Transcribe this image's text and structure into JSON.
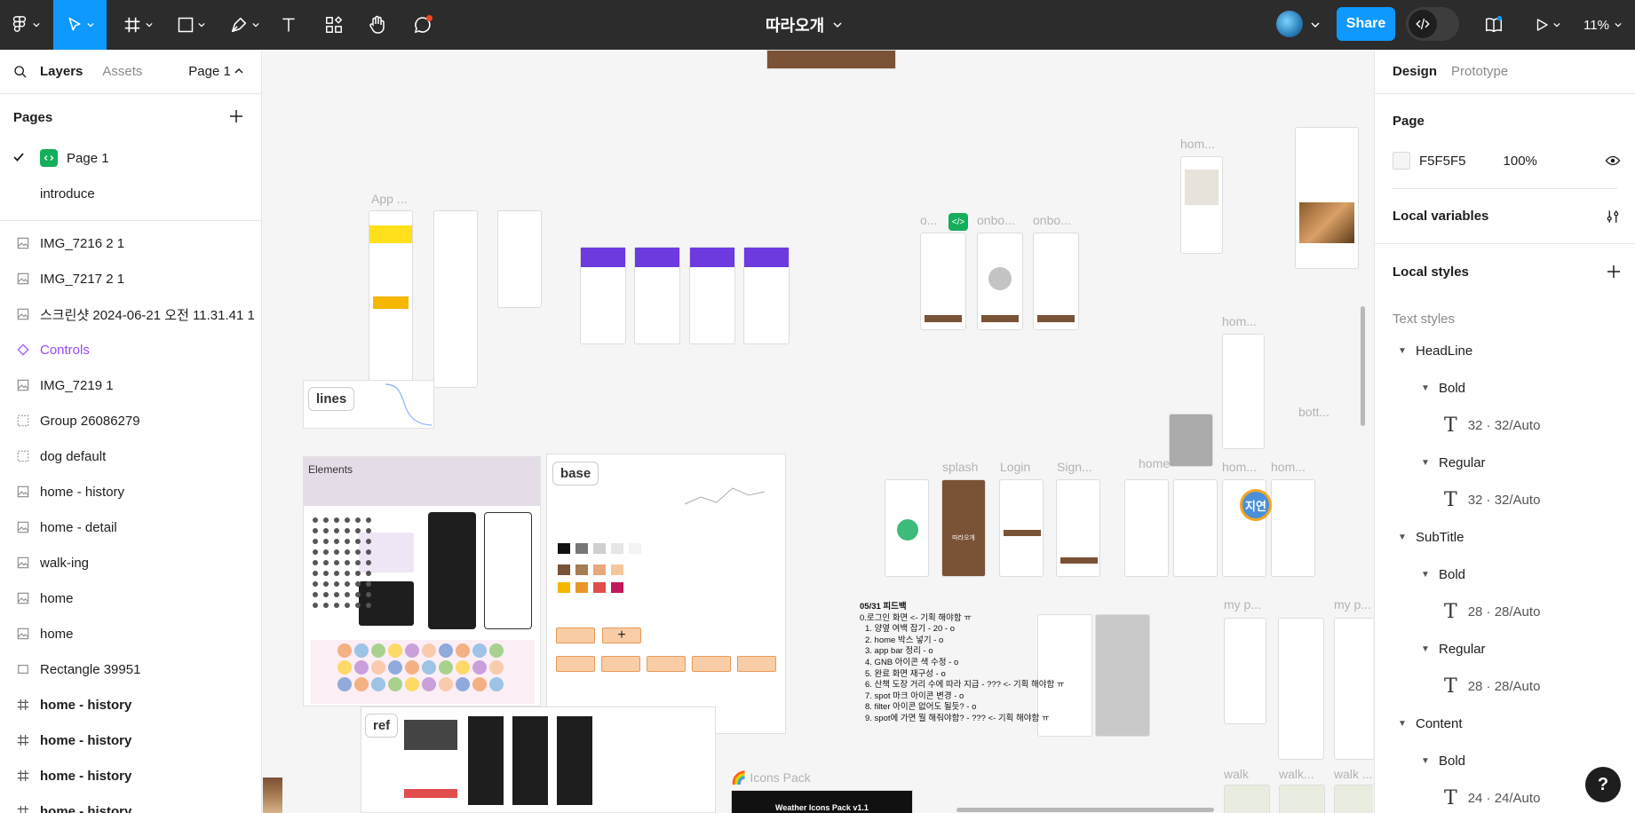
{
  "toolbar": {
    "doc_title": "따라오개",
    "share_label": "Share",
    "zoom": "11%",
    "colors": {
      "bg": "#2c2c2c",
      "accent": "#0d99ff"
    }
  },
  "left_panel": {
    "tabs": {
      "layers": "Layers",
      "assets": "Assets"
    },
    "page_selector": "Page 1",
    "pages_heading": "Pages",
    "pages": [
      {
        "label": "Page 1",
        "selected": true
      },
      {
        "label": "introduce",
        "selected": false
      }
    ],
    "layers": [
      {
        "label": "IMG_7216 2 1",
        "type": "image"
      },
      {
        "label": "IMG_7217 2 1",
        "type": "image"
      },
      {
        "label": "스크린샷 2024-06-21 오전 11.31.41 1",
        "type": "image"
      },
      {
        "label": "Controls",
        "type": "component"
      },
      {
        "label": "IMG_7219 1",
        "type": "image"
      },
      {
        "label": "Group 26086279",
        "type": "group"
      },
      {
        "label": "dog default",
        "type": "group"
      },
      {
        "label": "home - history",
        "type": "image"
      },
      {
        "label": "home - detail",
        "type": "image"
      },
      {
        "label": "walk-ing",
        "type": "image"
      },
      {
        "label": "home",
        "type": "image"
      },
      {
        "label": "home",
        "type": "image"
      },
      {
        "label": "Rectangle 39951",
        "type": "rect"
      },
      {
        "label": "home - history",
        "type": "frame"
      },
      {
        "label": "home - history",
        "type": "frame"
      },
      {
        "label": "home - history",
        "type": "frame"
      },
      {
        "label": "home - history",
        "type": "frame"
      }
    ]
  },
  "right_panel": {
    "tabs": {
      "design": "Design",
      "prototype": "Prototype"
    },
    "page_section": {
      "title": "Page",
      "fill_hex": "F5F5F5",
      "opacity": "100%"
    },
    "local_variables": "Local variables",
    "local_styles": "Local styles",
    "text_styles_label": "Text styles",
    "text_styles": [
      {
        "group": "HeadLine",
        "weights": [
          {
            "name": "Bold",
            "meta": "32 · 32/Auto"
          },
          {
            "name": "Regular",
            "meta": "32 · 32/Auto"
          }
        ]
      },
      {
        "group": "SubTitle",
        "weights": [
          {
            "name": "Bold",
            "meta": "28 · 28/Auto"
          },
          {
            "name": "Regular",
            "meta": "28 · 28/Auto"
          }
        ]
      },
      {
        "group": "Content",
        "weights": [
          {
            "name": "Bold",
            "meta": "24 · 24/Auto"
          }
        ]
      }
    ]
  },
  "canvas": {
    "labels": {
      "app": "App ...",
      "lines": "lines",
      "elements": "Elements",
      "base": "base",
      "ref": "ref",
      "icons_pack": "🌈 Icons Pack",
      "weather": "Weather Icons Pack v1.1",
      "splash": "splash",
      "login": "Login",
      "sign": "Sign...",
      "home1": "home",
      "home2": "hom...",
      "home3": "hom...",
      "home4": "hom...",
      "home5": "hom...",
      "bott": "bott...",
      "o": "o...",
      "onbo1": "onbo...",
      "onbo2": "onbo...",
      "my1": "my p...",
      "my2": "my p...",
      "walk1": "walk",
      "walk2": "walk...",
      "walk3": "walk ...",
      "splash_brand": "따라오개",
      "cursor_user": "지연"
    },
    "notes": {
      "title": "05/31 피드백",
      "lines": [
        "0.로그인 화면 <- 기획 해야함 ㅠ",
        "1. 양옆 여백 잡기 - 20 - o",
        "2. home 박스 넣기 - o",
        "3. app bar 정리 - o",
        "4. GNB 아이콘 색 수정 - o",
        "5. 완료 화면 재구성 - o",
        "6. 산책 도장 거리 수에 따라 지급 - ??? <- 기획 해야함 ㅠ",
        "7. spot 마크 아이콘 변경 - o",
        "8. filter 아이콘 없어도 될듯? - o",
        "9. spot에 가면 뭘 해줘야함? - ??? <- 기획 해야함 ㅠ"
      ]
    }
  }
}
